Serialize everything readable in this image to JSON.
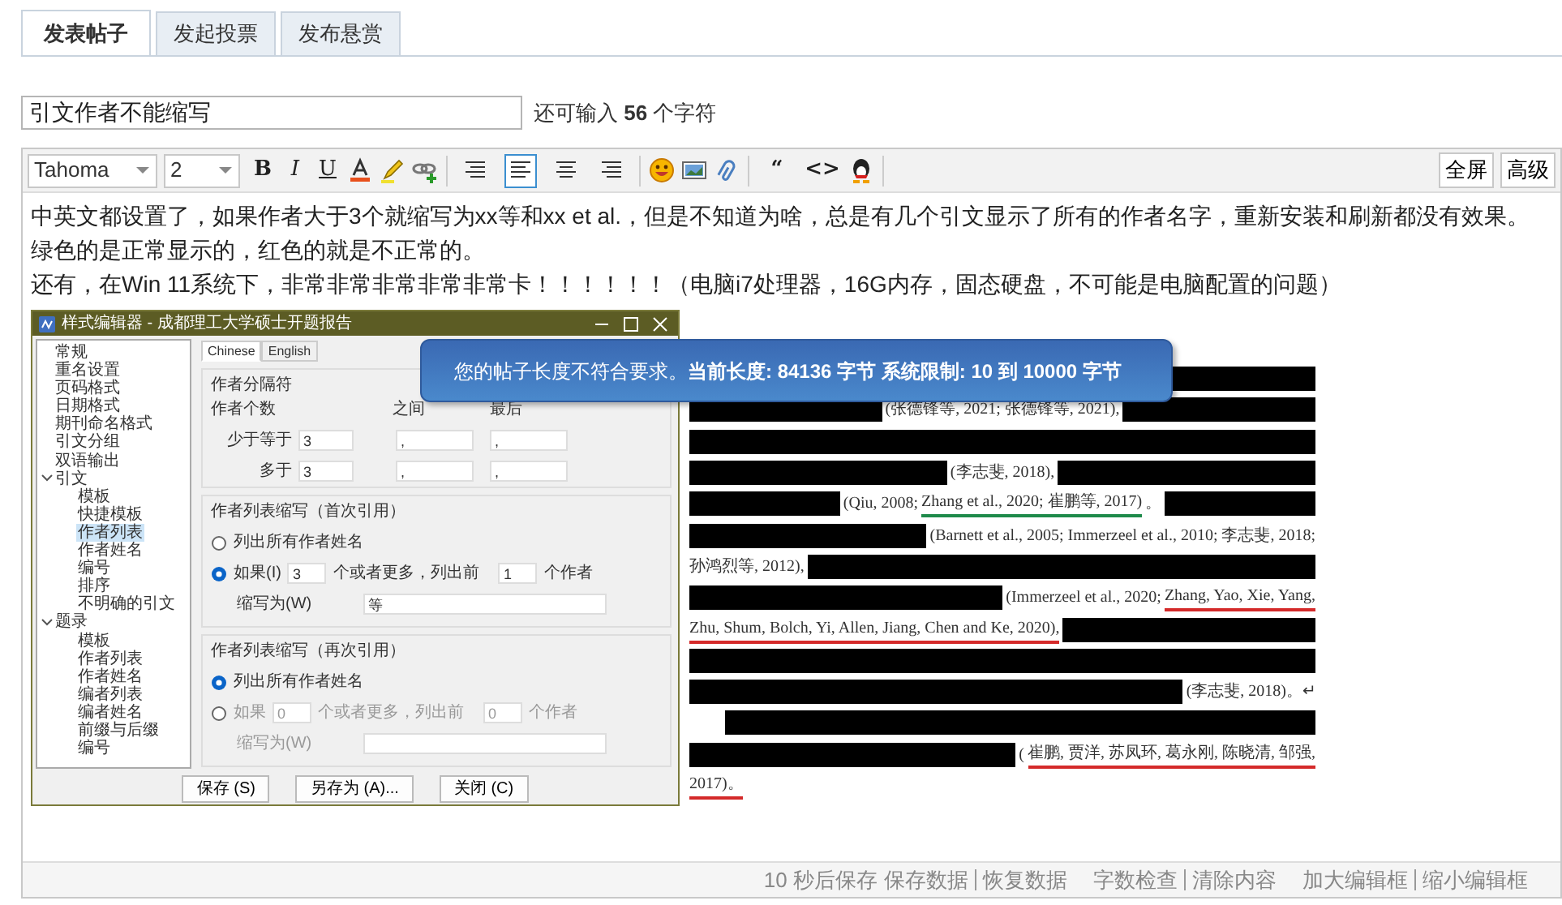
{
  "tabs": [
    {
      "label": "发表帖子",
      "selected": true
    },
    {
      "label": "发起投票",
      "selected": false
    },
    {
      "label": "发布悬赏",
      "selected": false
    }
  ],
  "subject": {
    "value": "引文作者不能缩写",
    "remaining": "还可输入 **56** 个字符"
  },
  "toolbar": {
    "font": "Tahoma",
    "size": "2",
    "format_buttons": [
      "B",
      "I",
      "U"
    ],
    "align_buttons": [
      {
        "selected": false
      },
      {
        "selected": true
      },
      {
        "selected": false
      },
      {
        "selected": false
      }
    ],
    "insert_buttons": [
      "“",
      "<>"
    ],
    "right_buttons": [
      "全屏",
      "高级"
    ]
  },
  "post_body": {
    "paragraphs": [
      "中英文都设置了，如果作者大于3个就缩写为xx等和xx et al.，但是不知道为啥，总是有几个引文显示了所有的作者名字，重新安装和刷新都没有效果。",
      "绿色的是正常显示的，红色的就是不正常的。",
      "还有，在Win 11系统下，非常非常非常非常非常卡！！！！！！（电脑i7处理器，16G内存，固态硬盘，不可能是电脑配置的问题）"
    ],
    "image": {
      "dialog": {
        "title": "样式编辑器 - 成都理工大学硕士开题报告",
        "tree": [
          {
            "label": "常规",
            "selected": false
          },
          {
            "label": "重名设置",
            "selected": false
          },
          {
            "label": "页码格式",
            "selected": false
          },
          {
            "label": "日期格式",
            "selected": false
          },
          {
            "label": "期刊命名格式",
            "selected": false
          },
          {
            "label": "引文分组",
            "selected": false
          },
          {
            "label": "双语输出",
            "selected": false
          },
          {
            "label": "引文",
            "selected": false,
            "expanded": true,
            "children": [
              {
                "label": "模板",
                "selected": false
              },
              {
                "label": "快捷模板",
                "selected": false
              },
              {
                "label": "作者列表",
                "selected": true
              },
              {
                "label": "作者姓名",
                "selected": false
              },
              {
                "label": "编号",
                "selected": false
              },
              {
                "label": "排序",
                "selected": false
              },
              {
                "label": "不明确的引文",
                "selected": false
              }
            ]
          },
          {
            "label": "题录",
            "selected": false,
            "expanded": true,
            "children": [
              {
                "label": "模板",
                "selected": false
              },
              {
                "label": "作者列表",
                "selected": false
              },
              {
                "label": "作者姓名",
                "selected": false
              },
              {
                "label": "编者列表",
                "selected": false
              },
              {
                "label": "编者姓名",
                "selected": false
              },
              {
                "label": "前缀与后缀",
                "selected": false
              },
              {
                "label": "编号",
                "selected": false
              }
            ]
          }
        ],
        "tabs": [
          {
            "label": "Chinese",
            "selected": true
          },
          {
            "label": "English",
            "selected": false
          }
        ],
        "separator_group": {
          "title": "作者分隔符",
          "headers": [
            "作者个数",
            "之间",
            "最后"
          ],
          "rows": [
            {
              "label": "少于等于",
              "count": "3",
              "between": ",",
              "last": ","
            },
            {
              "label": "多于",
              "count": "3",
              "between": ",",
              "last": ","
            }
          ]
        },
        "abbrev_groups": [
          {
            "title": "作者列表缩写（首次引用）",
            "options": [
              {
                "label": "列出所有作者姓名",
                "selected": false
              },
              {
                "label": "如果(I)",
                "selected": true
              }
            ],
            "disabled": false,
            "if_count": "3",
            "middle": "个或者更多，列出前",
            "first_count": "1",
            "tail": "个作者",
            "abbrev_label": "缩写为(W)",
            "abbrev_value": "等"
          },
          {
            "title": "作者列表缩写（再次引用）",
            "options": [
              {
                "label": "列出所有作者姓名",
                "selected": true
              },
              {
                "label": "如果",
                "selected": false
              }
            ],
            "disabled": true,
            "if_count": "0",
            "middle": "个或者更多，列出前",
            "first_count": "0",
            "tail": "个作者",
            "abbrev_label": "缩写为(W)"
          }
        ],
        "buttons": [
          "保存 (S)",
          "另存为 (A)...",
          "关闭 (C)"
        ]
      },
      "document": {
        "lines": [
          {
            "segments": [
              {
                "kind": "bar"
              }
            ]
          },
          {
            "segments": [
              {
                "kind": "bar"
              },
              {
                "kind": "text",
                "text": "(张德锋等, 2021; 张德锋等, 2021),"
              },
              {
                "kind": "bar"
              }
            ]
          },
          {
            "segments": [
              {
                "kind": "bar"
              }
            ]
          },
          {
            "segments": [
              {
                "kind": "bar"
              },
              {
                "kind": "text",
                "text": "(李志斐, 2018),"
              },
              {
                "kind": "bar"
              }
            ]
          },
          {
            "segments": [
              {
                "kind": "bar"
              },
              {
                "kind": "text",
                "text": "(Qiu, 2008; "
              },
              {
                "kind": "text",
                "text": "Zhang et al., 2020; 崔鹏等, 2017)",
                "color": "#1e8a4a"
              },
              {
                "kind": "text",
                "text": "。"
              },
              {
                "kind": "bar"
              }
            ]
          },
          {
            "segments": [
              {
                "kind": "bar"
              },
              {
                "kind": "text",
                "text": "(Barnett et al., 2005; Immerzeel et al., 2010; 李志斐, 2018;"
              }
            ]
          },
          {
            "segments": [
              {
                "kind": "text",
                "text": "孙鸿烈等, 2012),"
              },
              {
                "kind": "bar"
              }
            ]
          },
          {
            "segments": [
              {
                "kind": "bar"
              },
              {
                "kind": "text",
                "text": "(Immerzeel et al., 2020; "
              },
              {
                "kind": "text",
                "text": "Zhang, Yao, Xie, Yang,",
                "color": "#d42a2a"
              }
            ]
          },
          {
            "segments": [
              {
                "kind": "text",
                "text": "Zhu, Shum, Bolch, Yi, Allen, Jiang, Chen and Ke, 2020),",
                "color": "#d42a2a"
              },
              {
                "kind": "bar"
              }
            ]
          },
          {
            "segments": [
              {
                "kind": "bar"
              }
            ]
          },
          {
            "segments": [
              {
                "kind": "bar"
              },
              {
                "kind": "text",
                "text": "(李志斐, 2018)。↵"
              }
            ]
          },
          {
            "segments": [
              {
                "kind": "indent"
              },
              {
                "kind": "bar"
              }
            ]
          },
          {
            "segments": [
              {
                "kind": "bar"
              },
              {
                "kind": "text",
                "text": "("
              },
              {
                "kind": "text",
                "text": "崔鹏, 贾洋, 苏凤环, 葛永刚, 陈晓清, 邹强,",
                "color": "#d42a2a"
              }
            ]
          },
          {
            "segments": [
              {
                "kind": "text",
                "text": "2017)。",
                "color": "#d42a2a"
              }
            ]
          }
        ]
      }
    }
  },
  "tooltip": "您的帖子长度不符合要求。 **当前长度: 84136 字节 系统限制: 10 到 10000 字节**",
  "status_bar": {
    "autosave": "10 秒后保存",
    "link_groups": [
      [
        "保存数据",
        "恢复数据"
      ],
      [
        "字数检查",
        "清除内容"
      ],
      [
        "加大编辑框",
        "缩小编辑框"
      ]
    ]
  }
}
